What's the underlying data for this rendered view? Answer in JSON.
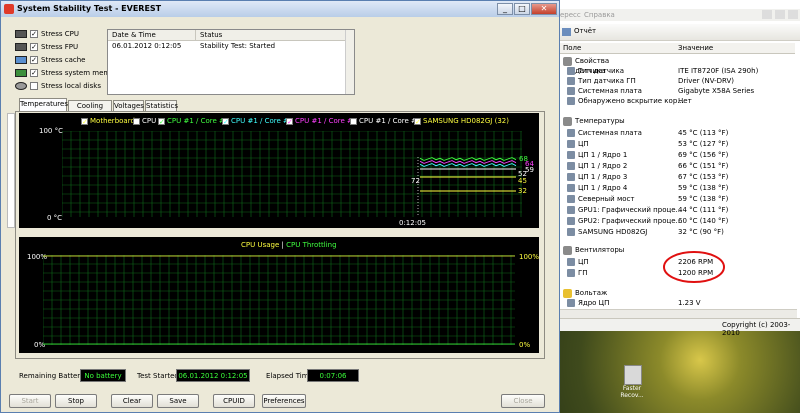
{
  "desktop": {
    "icon_label": "Faster Recov..."
  },
  "stability": {
    "title": "System Stability Test - EVEREST",
    "window_buttons": {
      "minimize": "_",
      "maximize": "□",
      "close": "✕"
    },
    "options": [
      {
        "label": "Stress CPU",
        "checked": true
      },
      {
        "label": "Stress FPU",
        "checked": true
      },
      {
        "label": "Stress cache",
        "checked": true
      },
      {
        "label": "Stress system memory",
        "checked": true
      },
      {
        "label": "Stress local disks",
        "checked": false
      }
    ],
    "log": {
      "headers": [
        "Date & Time",
        "Status"
      ],
      "rows": [
        {
          "time": "06.01.2012 0:12:05",
          "status": "Stability Test: Started"
        }
      ]
    },
    "tabs": [
      "Temperatures",
      "Cooling Fans",
      "Voltages",
      "Statistics"
    ],
    "temp_graph": {
      "legend": [
        {
          "label": "Motherboard",
          "color": "#ffff40"
        },
        {
          "label": "CPU",
          "color": "#ffffff"
        },
        {
          "label": "CPU #1 / Core #1",
          "color": "#40ff40"
        },
        {
          "label": "CPU #1 / Core #2",
          "color": "#40ffff"
        },
        {
          "label": "CPU #1 / Core #3",
          "color": "#ff40ff"
        },
        {
          "label": "CPU #1 / Core #4",
          "color": "#ffffff"
        },
        {
          "label": "SAMSUNG HD082GJ (32)",
          "color": "#ffff40"
        }
      ],
      "ymax_label": "100 °C",
      "ymin_label": "0 °C",
      "time_label": "0:12:05",
      "values": [
        "68",
        "64",
        "59",
        "52",
        "45",
        "32"
      ],
      "side_label": "72"
    },
    "cpu_graph": {
      "title_usage": "CPU Usage",
      "separator": "|",
      "title_throttling": "CPU Throttling",
      "left_max": "100%",
      "left_min": "0%",
      "right_max": "100%",
      "right_min": "0%"
    },
    "status": {
      "battery_label": "Remaining Battery:",
      "battery_value": "No battery",
      "started_label": "Test Started:",
      "started_value": "06.01.2012 0:12:05",
      "elapsed_label": "Elapsed Time:",
      "elapsed_value": "0:07:06"
    },
    "buttons": {
      "start": "Start",
      "stop": "Stop",
      "clear": "Clear",
      "save": "Save",
      "cpuid": "CPUID",
      "preferences": "Preferences",
      "close": "Close"
    }
  },
  "report": {
    "menu": [
      "ересс",
      "Справка"
    ],
    "toolbar_label": "Отчёт",
    "headers": [
      "Поле",
      "Значение"
    ],
    "sections": [
      {
        "title": "Свойства датчика",
        "rows": [
          {
            "field": "Тип датчика",
            "value": "ITE IT8720F (ISA 290h)"
          },
          {
            "field": "Тип датчика ГП",
            "value": "Driver (NV-DRV)"
          },
          {
            "field": "Системная плата",
            "value": "Gigabyte X58A Series"
          },
          {
            "field": "Обнаружено вскрытие кор...",
            "value": "Нет"
          }
        ]
      },
      {
        "title": "Температуры",
        "rows": [
          {
            "field": "Системная плата",
            "value": "45 °C (113 °F)"
          },
          {
            "field": "ЦП",
            "value": "53 °C (127 °F)"
          },
          {
            "field": "ЦП 1 / Ядро 1",
            "value": "69 °C (156 °F)"
          },
          {
            "field": "ЦП 1 / Ядро 2",
            "value": "66 °C (151 °F)"
          },
          {
            "field": "ЦП 1 / Ядро 3",
            "value": "67 °C (153 °F)"
          },
          {
            "field": "ЦП 1 / Ядро 4",
            "value": "59 °C (138 °F)"
          },
          {
            "field": "Северный мост",
            "value": "59 °C (138 °F)"
          },
          {
            "field": "GPU1: Графический проце...",
            "value": "44 °C (111 °F)"
          },
          {
            "field": "GPU2: Графический проце...",
            "value": "60 °C (140 °F)"
          },
          {
            "field": "SAMSUNG HD082GJ",
            "value": "32 °C (90 °F)"
          }
        ]
      },
      {
        "title": "Вентиляторы",
        "rows": [
          {
            "field": "ЦП",
            "value": "2206 RPM"
          },
          {
            "field": "ГП",
            "value": "1200 RPM"
          }
        ]
      },
      {
        "title": "Вольтаж",
        "rows": [
          {
            "field": "Ядро ЦП",
            "value": "1.23 V"
          }
        ]
      }
    ],
    "copyright": "Copyright (c) 2003-2010"
  }
}
